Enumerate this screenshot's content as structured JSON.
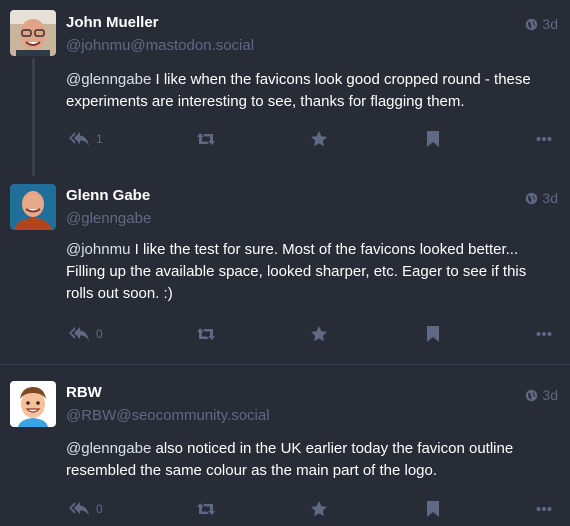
{
  "statuses": [
    {
      "display_name": "John Mueller",
      "handle": "@johnmu@mastodon.social",
      "time": "3d",
      "mention": "@glenngabe",
      "text": " I like when the favicons look good cropped round - these experiments are interesting to see, thanks for flagging them.",
      "reply_count": "1",
      "avatar_icon": "avatar-john-mueller"
    },
    {
      "display_name": "Glenn Gabe",
      "handle": "@glenngabe",
      "time": "3d",
      "mention": "@johnmu",
      "text": " I like the test for sure. Most of the favicons looked better... Filling up the available space, looked sharper, etc. Eager to see if this rolls out soon. :)",
      "reply_count": "0",
      "avatar_icon": "avatar-glenn-gabe"
    },
    {
      "display_name": "RBW",
      "handle": "@RBW@seocommunity.social",
      "time": "3d",
      "mention": "@glenngabe",
      "text": " also noticed in the UK earlier today the favicon outline resembled the same colour as the main part of the logo.",
      "reply_count": "0",
      "avatar_icon": "avatar-rbw-cartoon"
    }
  ],
  "icons": {
    "visibility": "globe-icon",
    "reply": "reply-all-icon",
    "boost": "retweet-icon",
    "favourite": "star-icon",
    "bookmark": "bookmark-icon",
    "more": "ellipsis-icon"
  },
  "colors": {
    "background": "#282c37",
    "muted": "#606984",
    "text": "#ffffff",
    "divider": "#393f4f"
  }
}
